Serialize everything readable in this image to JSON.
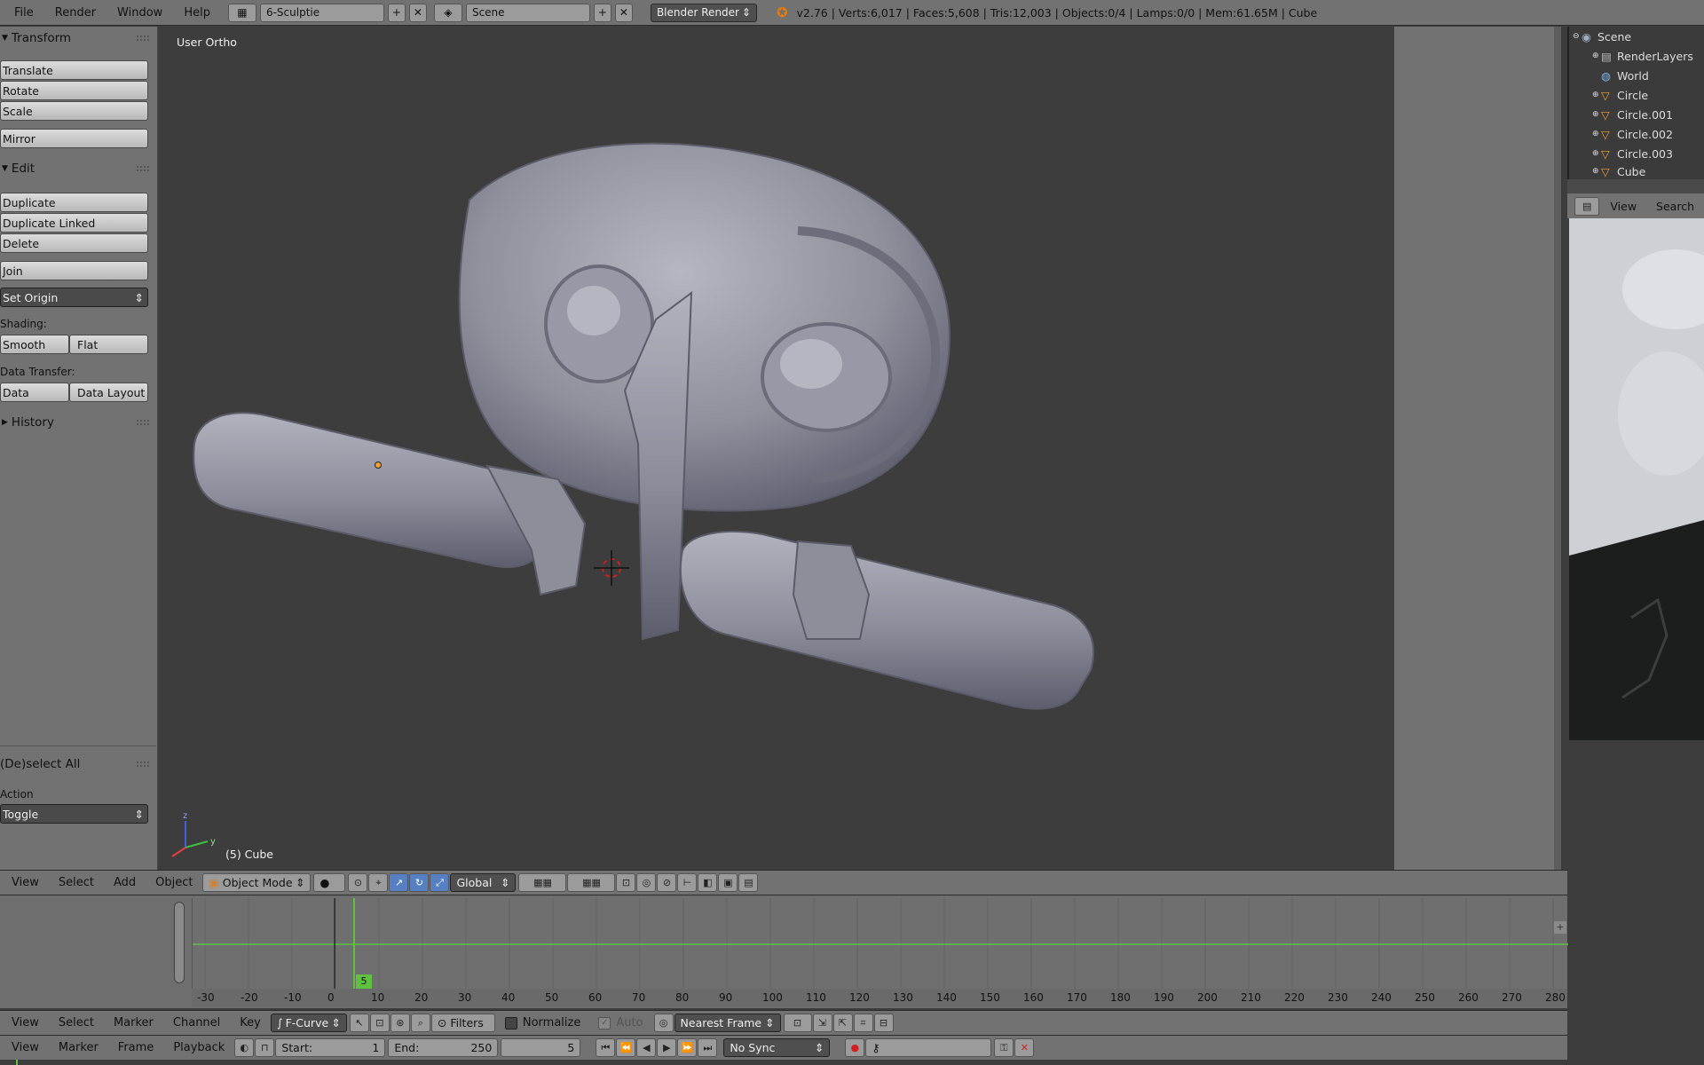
{
  "topbar": {
    "menus": [
      "File",
      "Render",
      "Window",
      "Help"
    ],
    "layout_name": "6-Sculptie",
    "scene_name": "Scene",
    "render_engine": "Blender Render",
    "info": "v2.76 | Verts:6,017 | Faces:5,608 | Tris:12,003 | Objects:0/4 | Lamps:0/0 | Mem:61.65M | Cube"
  },
  "toolshelf": {
    "transform_header": "Transform",
    "translate": "Translate",
    "rotate": "Rotate",
    "scale": "Scale",
    "mirror": "Mirror",
    "edit_header": "Edit",
    "duplicate": "Duplicate",
    "duplicate_linked": "Duplicate Linked",
    "delete": "Delete",
    "join": "Join",
    "set_origin": "Set Origin",
    "shading_label": "Shading:",
    "smooth": "Smooth",
    "flat": "Flat",
    "data_transfer_label": "Data Transfer:",
    "data": "Data",
    "data_layout": "Data Layout",
    "history_header": "History",
    "operator_header": "(De)select All",
    "operator_label": "Action",
    "operator_value": "Toggle"
  },
  "viewport": {
    "view_label": "User Ortho",
    "object_label": "(5) Cube",
    "axis_z": "z",
    "axis_y": "y"
  },
  "outliner": {
    "items": [
      "Scene",
      "RenderLayers",
      "World",
      "Circle",
      "Circle.001",
      "Circle.002",
      "Circle.003",
      "Cube"
    ]
  },
  "image_editor": {
    "view": "View",
    "search": "Search"
  },
  "view3d_header": {
    "menus": [
      "View",
      "Select",
      "Add",
      "Object"
    ],
    "mode": "Object Mode",
    "orientation": "Global"
  },
  "timeline": {
    "current_frame_badge": "5",
    "ruler_labels": [
      "-30",
      "-20",
      "-10",
      "0",
      "10",
      "20",
      "30",
      "40",
      "50",
      "60",
      "70",
      "80",
      "90",
      "100",
      "110",
      "120",
      "130",
      "140",
      "150",
      "160",
      "170",
      "180",
      "190",
      "200",
      "210",
      "220",
      "230",
      "240",
      "250",
      "260",
      "270",
      "280"
    ]
  },
  "graph_header": {
    "menus": [
      "View",
      "Select",
      "Marker",
      "Channel",
      "Key"
    ],
    "mode": "F-Curve",
    "filters": "Filters",
    "normalize": "Normalize",
    "auto": "Auto",
    "snap": "Nearest Frame"
  },
  "timeline_header": {
    "menus": [
      "View",
      "Marker",
      "Frame",
      "Playback"
    ],
    "start_label": "Start:",
    "start_value": "1",
    "end_label": "End:",
    "end_value": "250",
    "frame_value": "5",
    "sync": "No Sync"
  },
  "colors": {
    "accent": "#5680c2",
    "frame_line": "#60c040",
    "bg": "#3d3d3d"
  }
}
